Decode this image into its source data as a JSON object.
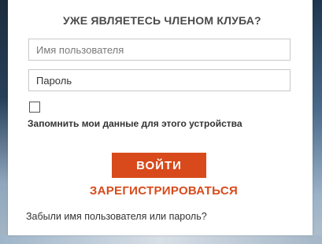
{
  "login": {
    "title": "УЖЕ ЯВЛЯЕТЕСЬ ЧЛЕНОМ КЛУБА?",
    "username_placeholder": "Имя пользователя",
    "password_placeholder": "Пароль",
    "remember_label": "Запомнить мои данные для этого устройства",
    "remember_checked": false,
    "login_button": "ВОЙТИ",
    "register_link": "ЗАРЕГИСТРИРОВАТЬСЯ",
    "forgot_link": "Забыли имя пользователя или пароль?"
  },
  "colors": {
    "accent": "#d84a1b",
    "text": "#333333",
    "title": "#4a4a4a"
  }
}
